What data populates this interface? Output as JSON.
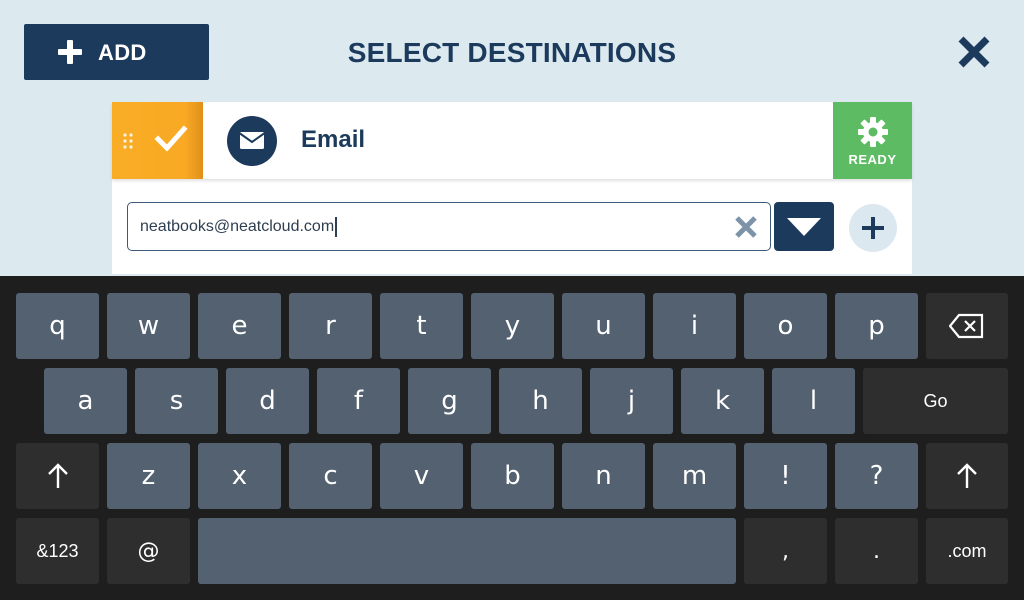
{
  "header": {
    "add_label": "ADD",
    "title": "SELECT DESTINATIONS"
  },
  "destination": {
    "label": "Email",
    "status": "READY",
    "email_value": "neatbooks@neatcloud.com"
  },
  "colors": {
    "navy": "#1b3a5c",
    "accent_orange": "#f9ad25",
    "ready_green": "#5cbb63",
    "key_bg": "#536170",
    "keyboard_bg": "#1e1e1e"
  },
  "keyboard": {
    "row1": [
      "q",
      "w",
      "e",
      "r",
      "t",
      "y",
      "u",
      "i",
      "o",
      "p"
    ],
    "row2": [
      "a",
      "s",
      "d",
      "f",
      "g",
      "h",
      "j",
      "k",
      "l"
    ],
    "row3": [
      "z",
      "x",
      "c",
      "v",
      "b",
      "n",
      "m",
      "!",
      "?"
    ],
    "go_label": "Go",
    "symbols_label": "&123",
    "at_label": "@",
    "comma_label": ",",
    "period_label": ".",
    "dotcom_label": ".com"
  }
}
